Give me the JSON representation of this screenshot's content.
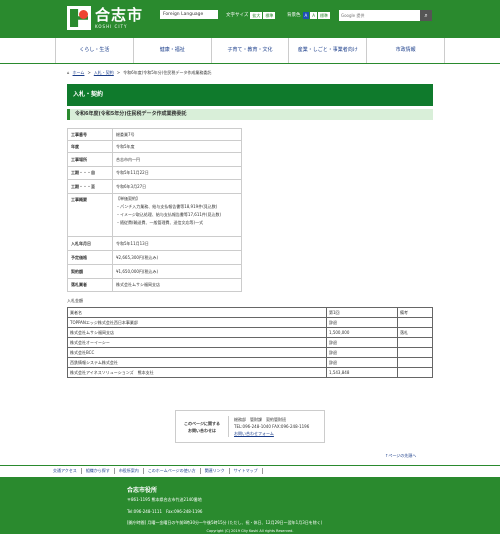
{
  "header": {
    "logo_name": "合志市",
    "logo_sub": "KOSHI CITY",
    "lang_button": "Foreign Language",
    "font_size_label": "文字サイズ",
    "font_size_buttons": [
      "拡大",
      "標準"
    ],
    "bg_color_label": "背景色",
    "bg_color_buttons": [
      "A",
      "A",
      "標準"
    ],
    "search_placeholder": "Google 提供",
    "search_icon": "search-icon"
  },
  "nav": {
    "items": [
      "くらし・生活",
      "健康・福祉",
      "子育て・教育・文化",
      "産業・しごと・事業者向け",
      "市政情報"
    ]
  },
  "breadcrumb": {
    "home": "ホーム",
    "sep1": ">",
    "item1": "入札・契約",
    "sep2": ">",
    "current": "令和6年度(令和5年分)住民税データ作成業務委託"
  },
  "section_title": "入札・契約",
  "page_title": "令和6年度(令和5年分)住民税データ作成業務委託",
  "details": [
    {
      "k": "工事番号",
      "v": "総委業7号"
    },
    {
      "k": "年度",
      "v": "令和5年度"
    },
    {
      "k": "工事場所",
      "v": "合志市内一円"
    },
    {
      "k": "工期・・・自",
      "v": "令和5年11月22日"
    },
    {
      "k": "工期・・・至",
      "v": "令和6年3月27日"
    },
    {
      "k": "工事概要",
      "v1": "【単価契約】",
      "v2": "・パンチ入力業務、給与支払報告書等18,919件(見込数)",
      "v3": "・イメージ取込処理、給与支払報告書等17,611件(見込数)",
      "v4": "・随従費(輸送費、一般管理費、送信文応等)一式"
    },
    {
      "k": "入札年月日",
      "v": "令和5年11月13日"
    },
    {
      "k": "予定価格",
      "v": "¥2,665,300円(税込み)"
    },
    {
      "k": "契約額",
      "v": "¥1,650,000円(税込み)"
    },
    {
      "k": "落札業者",
      "v": "株式会社ムサシ福岡支店"
    }
  ],
  "bid_title": "入札金額",
  "bids": {
    "headers": [
      "業者名",
      "第1回",
      "備考"
    ],
    "rows": [
      [
        "TOPPANエッジ株式会社西日本事業部",
        "辞退",
        ""
      ],
      [
        "株式会社ムサシ福岡支店",
        "1,500,000",
        "落札"
      ],
      [
        "株式会社オーイーシー",
        "辞退",
        ""
      ],
      [
        "株式会社BCC",
        "辞退",
        ""
      ],
      [
        "西鉄情報システム株式会社",
        "辞退",
        ""
      ],
      [
        "株式会社アイネスソリューションズ　熊本支社",
        "1,543,848",
        ""
      ]
    ]
  },
  "contact": {
    "heading1": "このページに関する",
    "heading2": "お問い合わせは",
    "dept": "総務部　管財課　契約管財班",
    "tel": "TEL:096-248-1040 FAX:096-248-1196",
    "form_link": "お問い合わせフォーム"
  },
  "pagetop": "ページの先頭へ",
  "footer_links": [
    "交通アクセス",
    "組織から探す",
    "市役所案内",
    "このホームページの使い方",
    "関連リンク",
    "サイトマップ"
  ],
  "footer": {
    "name": "合志市役所",
    "address": "〒861-1195 熊本県合志市竹迫2140番地",
    "tel": "Tel:096-248-1111　Fax:096-248-1196",
    "hours": "[開庁時間] 月曜〜金曜日の午前8時30分〜午後5時15分 (ただし、祝・休日、12月29日〜翌年1月3日を除く)",
    "copyright": "Copyright (C) 2019 City Koshi All rights Reserved."
  }
}
